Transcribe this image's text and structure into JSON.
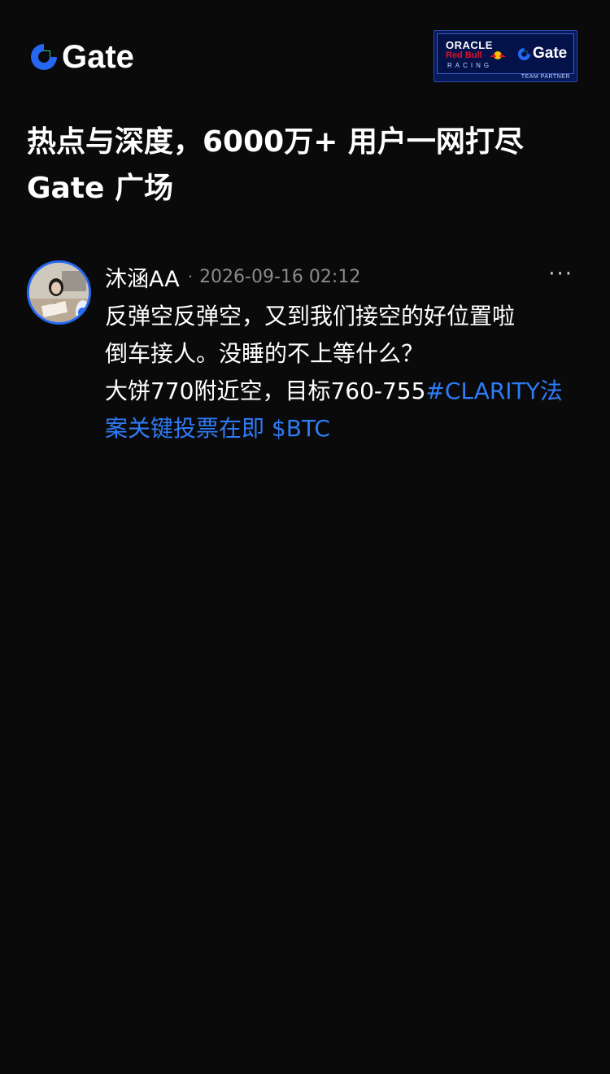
{
  "header": {
    "brand": "Gate",
    "partner": {
      "line1": "ORACLE",
      "line2": "Red Bull",
      "line3": "RACING",
      "brand": "Gate",
      "tag": "TEAM PARTNER"
    }
  },
  "headline": {
    "line1": "热点与深度，6000万+ 用户一网打尽",
    "line2": "Gate 广场"
  },
  "post": {
    "username": "沐涵AA",
    "separator": "·",
    "timestamp": "2026-09-16 02:12",
    "more": "···",
    "lines": [
      "反弹空反弹空，又到我们接空的好位置啦",
      "倒车接人。没睡的不上等什么？",
      "大饼770附近空，目标760-755"
    ],
    "hashtag_part1": "#CLARITY法",
    "hashtag_part2": "案关键投票在即",
    "cashtag": "$BTC"
  },
  "colors": {
    "background": "#0a0a0a",
    "accent": "#2f7bf5",
    "muted": "#8a8a8a"
  }
}
